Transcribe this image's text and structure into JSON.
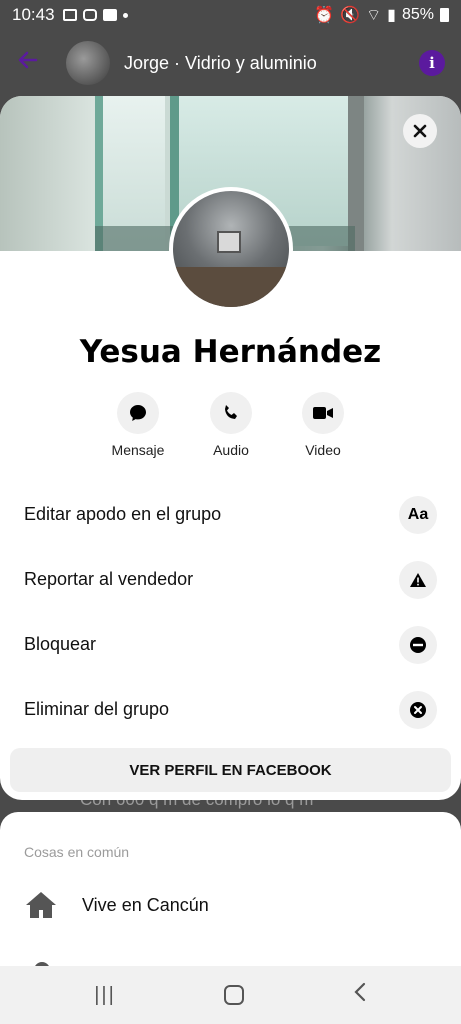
{
  "status_bar": {
    "time": "10:43",
    "battery": "85%"
  },
  "chat_header": {
    "title": "Jorge · Vidrio y aluminio"
  },
  "profile": {
    "name": "Yesua Hernández"
  },
  "actions": [
    {
      "label": "Mensaje",
      "icon": "message-icon"
    },
    {
      "label": "Audio",
      "icon": "phone-icon"
    },
    {
      "label": "Video",
      "icon": "video-camera-icon"
    }
  ],
  "menu": [
    {
      "label": "Editar apodo en el grupo",
      "icon_text": "Aa",
      "icon": "text-format-icon"
    },
    {
      "label": "Reportar al vendedor",
      "icon_text": "⚠",
      "icon": "warning-icon"
    },
    {
      "label": "Bloquear",
      "icon_text": "⛔",
      "icon": "block-icon"
    },
    {
      "label": "Eliminar del grupo",
      "icon_text": "✕",
      "icon": "remove-icon"
    }
  ],
  "facebook_button": "VER PERFIL EN FACEBOOK",
  "background_text": "Con 600 q m de compro lo q m",
  "common": {
    "title": "Cosas en común",
    "items": [
      {
        "label": "Vive en Cancún",
        "icon": "home-icon"
      }
    ]
  },
  "colors": {
    "accent": "#5b1a9e",
    "sheet_bg": "#ffffff",
    "overlay": "#4a4a4a"
  }
}
